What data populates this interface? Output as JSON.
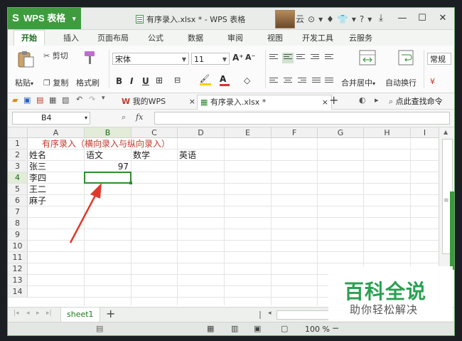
{
  "app": {
    "logo": "S",
    "name": "WPS 表格",
    "menu_arrow": "▾"
  },
  "window": {
    "title": "有序录入.xlsx * - WPS 表格",
    "user_initial": "云"
  },
  "title_icons": [
    "◌",
    "⊙",
    "▾",
    "♦",
    "👕",
    "▾",
    "?",
    "▾"
  ],
  "window_controls": {
    "restore_alt": "⤓",
    "minimize": "—",
    "maximize": "☐",
    "close": "✕"
  },
  "tabs": [
    "开始",
    "插入",
    "页面布局",
    "公式",
    "数据",
    "审阅",
    "视图",
    "开发工具",
    "云服务"
  ],
  "ribbon": {
    "paste": "粘贴",
    "paste_dd": "▾",
    "cut": "剪切",
    "copy": "复制",
    "format_painter": "格式刷",
    "font_name": "宋体",
    "font_size": "11",
    "font_grow": "A⁺",
    "font_shrink": "A⁻",
    "bold": "B",
    "italic": "I",
    "underline": "U",
    "border": "⊞",
    "fill_color": "🖌",
    "font_color": "A",
    "clear": "◇",
    "merge_center": "合并居中",
    "wrap_text": "自动换行",
    "number_format": "常规",
    "colors": {
      "fill_bar": "#f6d000",
      "font_bar": "#e03030"
    }
  },
  "quick_access_icons": [
    "📂",
    "💾",
    "🖨",
    "🖶",
    "↶",
    "↷",
    "▾"
  ],
  "doc_tabs": {
    "home": "我的WPS",
    "home_close": "×",
    "active": "有序录入.xlsx *",
    "active_close": "×",
    "add": "+"
  },
  "qa_right": {
    "search": "点此查找命令"
  },
  "formula_bar": {
    "name_box": "B4",
    "fx": "fx",
    "formula": ""
  },
  "grid": {
    "columns": [
      "A",
      "B",
      "C",
      "D",
      "E",
      "F",
      "G",
      "H",
      "I"
    ],
    "rows": [
      "1",
      "2",
      "3",
      "4",
      "5",
      "6",
      "7",
      "8",
      "9",
      "10",
      "11",
      "12",
      "13",
      "14"
    ],
    "active_column": "B",
    "active_row": "4",
    "cells": {
      "A1": "有序录入（横向录入与纵向录入）",
      "A2": "姓名",
      "B2": "语文",
      "C2": "数学",
      "D2": "英语",
      "A3": "张三",
      "B3": "97",
      "A4": "李四",
      "A5": "王二",
      "A6": "麻子"
    },
    "colors": {
      "title": "#c0392b",
      "selection": "#2f8c2f",
      "arrow": "#e0392b"
    }
  },
  "sheet_bar": {
    "sheet_name": "sheet1",
    "add": "+",
    "nav": [
      "|◂",
      "◂",
      "▸",
      "▸|"
    ]
  },
  "status_bar": {
    "zoom": "100 %",
    "zoom_minus": "−"
  },
  "watermark": {
    "title": "百科全说",
    "subtitle": "助你轻松解决"
  }
}
